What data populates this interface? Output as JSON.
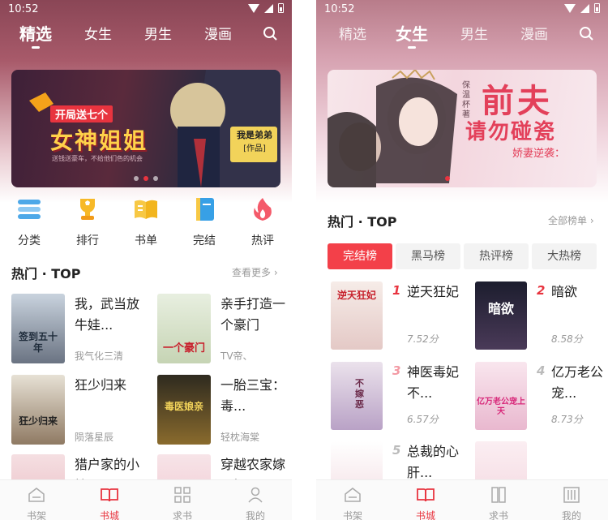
{
  "status": {
    "time": "10:52"
  },
  "colors": {
    "accent": "#e8343f",
    "chip_active": "#f34049"
  },
  "left": {
    "tabs": [
      "精选",
      "女生",
      "男生",
      "漫画"
    ],
    "active_tab": "精选",
    "banner": {
      "line1": "开局送七个",
      "line2": "女神姐姐",
      "tagline": "送钱送豪车，不给他们色的机会",
      "badge1": "我是弟弟",
      "badge2": "[作品]"
    },
    "quick_nav": [
      "分类",
      "排行",
      "书单",
      "完结",
      "热评"
    ],
    "section_title": "热门 · TOP",
    "section_more": "查看更多",
    "books": [
      {
        "title": "我，武当放牛娃...",
        "author": "我气化三清",
        "cover_text": "签到五十年"
      },
      {
        "title": "亲手打造一个豪门",
        "author": "TV帝、",
        "cover_text": "一个豪门"
      },
      {
        "title": "狂少归来",
        "author": "陨落星辰",
        "cover_text": "狂少归来"
      },
      {
        "title": "一胎三宝：毒...",
        "author": "轻枕海棠",
        "cover_text": "毒医娘亲"
      },
      {
        "title": "猎户家的小娘子",
        "author": "",
        "cover_text": ""
      },
      {
        "title": "穿越农家嫁恶婿",
        "author": "",
        "cover_text": ""
      }
    ],
    "bottom_nav": [
      "书架",
      "书城",
      "求书",
      "我的"
    ],
    "bottom_active": "书城"
  },
  "right": {
    "tabs": [
      "精选",
      "女生",
      "男生",
      "漫画"
    ],
    "active_tab": "女生",
    "banner": {
      "title1": "前夫",
      "title2": "请勿碰瓷",
      "subtitle": "娇妻逆袭：",
      "author_tag": "保温杯 著"
    },
    "section_title": "热门 · TOP",
    "section_more": "全部榜单",
    "chips": [
      "完结榜",
      "黑马榜",
      "热评榜",
      "大热榜"
    ],
    "active_chip": "完结榜",
    "ranks": [
      {
        "rank": "1",
        "title": "逆天狂妃",
        "score": "7.52分",
        "cover_text": "逆天狂妃"
      },
      {
        "rank": "2",
        "title": "暗欲",
        "score": "8.58分",
        "cover_text": "暗欲"
      },
      {
        "rank": "3",
        "title": "神医毒妃不...",
        "score": "6.57分",
        "cover_text": "不嫁恶"
      },
      {
        "rank": "4",
        "title": "亿万老公宠...",
        "score": "8.73分",
        "cover_text": "亿万老公宠上天"
      },
      {
        "rank": "5",
        "title": "总裁的心肝...",
        "score": "",
        "cover_text": ""
      }
    ],
    "bottom_nav": [
      "书架",
      "书城",
      "求书",
      "我的"
    ],
    "bottom_active": "书城"
  }
}
